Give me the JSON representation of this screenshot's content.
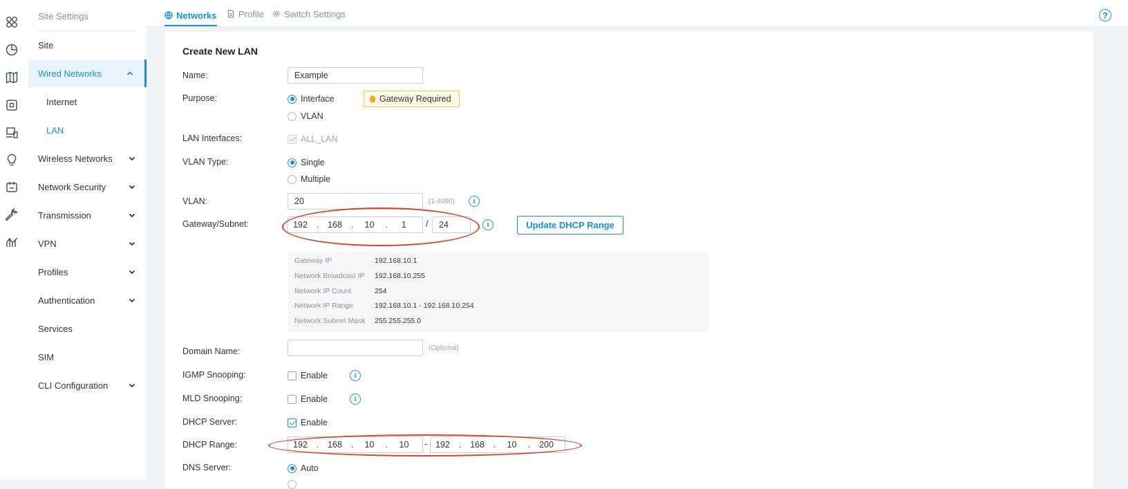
{
  "rail_icons": [
    "dashboard-icon",
    "statistics-icon",
    "map-icon",
    "devices-icon",
    "clients-icon",
    "insights-icon",
    "logs-icon",
    "tools-icon",
    "reports-icon"
  ],
  "sidebar": {
    "title": "Site Settings",
    "items": [
      {
        "label": "Site",
        "chevron": ""
      },
      {
        "label": "Wired Networks",
        "chevron": "up"
      },
      {
        "label": "Internet",
        "chevron": ""
      },
      {
        "label": "LAN",
        "chevron": ""
      },
      {
        "label": "Wireless Networks",
        "chevron": "down"
      },
      {
        "label": "Network Security",
        "chevron": "down"
      },
      {
        "label": "Transmission",
        "chevron": "down"
      },
      {
        "label": "VPN",
        "chevron": "down"
      },
      {
        "label": "Profiles",
        "chevron": "down"
      },
      {
        "label": "Authentication",
        "chevron": "down"
      },
      {
        "label": "Services",
        "chevron": ""
      },
      {
        "label": "SIM",
        "chevron": ""
      },
      {
        "label": "CLI Configuration",
        "chevron": "down"
      }
    ]
  },
  "tabs": [
    {
      "label": "Networks",
      "active": true
    },
    {
      "label": "Profile",
      "active": false
    },
    {
      "label": "Switch Settings",
      "active": false
    }
  ],
  "help_glyph": "?",
  "form": {
    "title": "Create New LAN",
    "name": {
      "label": "Name:",
      "value": "Example"
    },
    "purpose": {
      "label": "Purpose:",
      "interface": "Interface",
      "vlan": "VLAN",
      "gateway_badge": "Gateway Required"
    },
    "lan_interfaces": {
      "label": "LAN Interfaces:",
      "value": "ALL_LAN"
    },
    "vlan_type": {
      "label": "VLAN Type:",
      "single": "Single",
      "multiple": "Multiple"
    },
    "vlan": {
      "label": "VLAN:",
      "value": "20",
      "hint": "(1-4090)"
    },
    "gateway": {
      "label": "Gateway/Subnet:",
      "octets": [
        "192",
        "168",
        "10",
        "1"
      ],
      "mask": "24",
      "slash": "/"
    },
    "update_button": "Update DHCP Range",
    "summary": [
      {
        "key": "Gateway IP",
        "value": "192.168.10.1"
      },
      {
        "key": "Network Broadcast IP",
        "value": "192.168.10.255"
      },
      {
        "key": "Network IP Count",
        "value": "254"
      },
      {
        "key": "Network IP Range",
        "value": "192.168.10.1 - 192.168.10.254"
      },
      {
        "key": "Network Subnet Mask",
        "value": "255.255.255.0"
      }
    ],
    "domain": {
      "label": "Domain Name:",
      "value": "",
      "hint": "(Optional)"
    },
    "igmp": {
      "label": "IGMP Snooping:",
      "checkbox": "Enable"
    },
    "mld": {
      "label": "MLD Snooping:",
      "checkbox": "Enable"
    },
    "dhcp_server": {
      "label": "DHCP Server:",
      "checkbox": "Enable"
    },
    "dhcp_range": {
      "label": "DHCP Range:",
      "start": [
        "192",
        "168",
        "10",
        "10"
      ],
      "end": [
        "192",
        "168",
        "10",
        "200"
      ],
      "dash": "-"
    },
    "dns": {
      "label": "DNS Server:",
      "auto": "Auto"
    },
    "info_glyph": "i",
    "dot": "."
  },
  "colors": {
    "accent": "#1a8fd8",
    "annotation": "#d9452b",
    "badge_bg": "#fffbe6",
    "badge_border": "#f2c14e"
  }
}
